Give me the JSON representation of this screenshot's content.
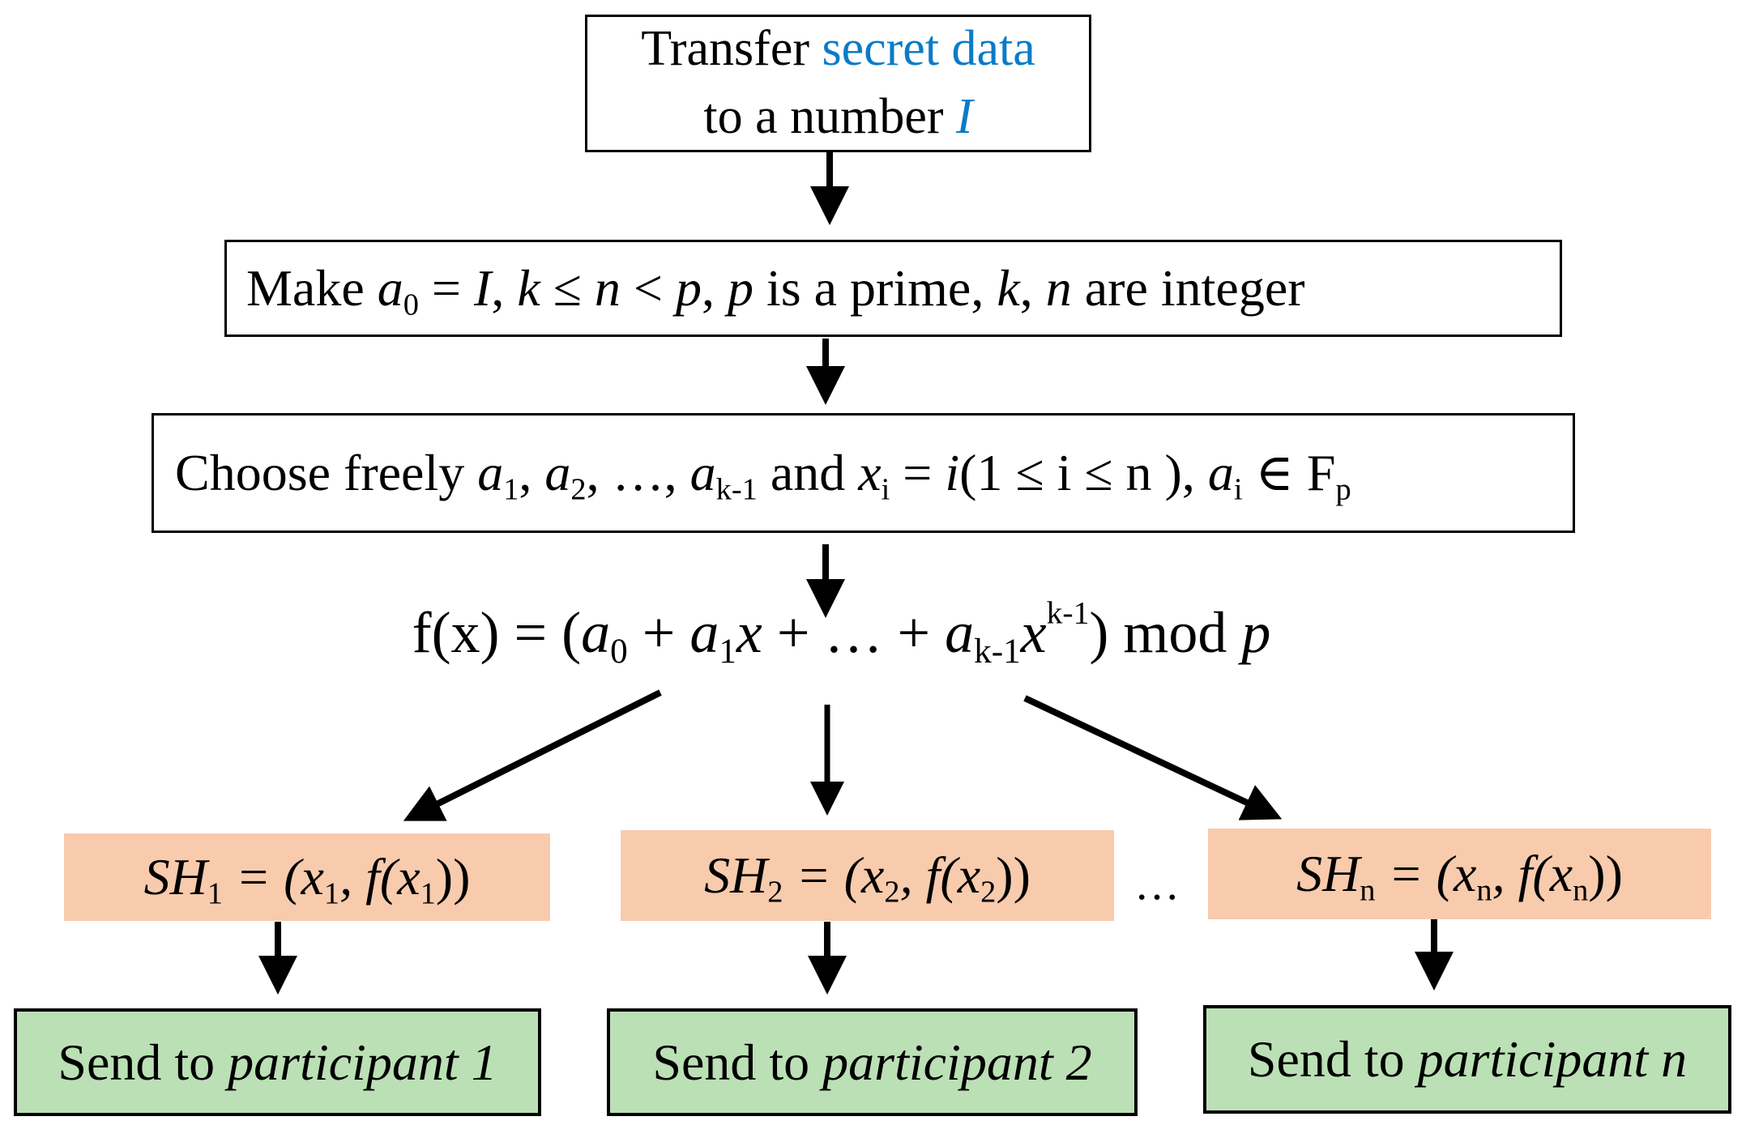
{
  "step1": {
    "pre": "Transfer ",
    "highlight": "secret data",
    "line2_pre": "to a number ",
    "line2_var": "I"
  },
  "step2": {
    "text_make": "Make ",
    "a": "a",
    "a_sub": "0",
    "eq": " = ",
    "I": "I",
    "rest_1": ", ",
    "k": "k",
    "le": " ≤ ",
    "n": "n",
    "lt": " < ",
    "p": "p",
    "comma": ", ",
    "p2": "p",
    "is_prime": " is a prime, ",
    "k2": "k",
    "comma2": ", ",
    "n2": "n",
    "are_int": " are integer"
  },
  "step3": {
    "choose": "Choose freely ",
    "coeffs": "a",
    "sub1": "1",
    "sub2": "2",
    "subk": "k-1",
    "sep": ", ",
    "dots": "…, ",
    "and": " and ",
    "x": "x",
    "xi_sub": "i",
    "eq": " = ",
    "i": "i",
    "range": "(1 ≤ i ≤ n ), ",
    "ai_sub": "i",
    "in": " ∈ F",
    "field_sub": "p"
  },
  "formula": {
    "lhs": "f(x) = (",
    "a": "a",
    "s0": "0",
    "plus": " + ",
    "s1": "1",
    "x": "x",
    "dots": " + … + ",
    "sk": "k-1",
    "exp": "k-1",
    "rhs": ") mod ",
    "p": "p"
  },
  "shares": [
    {
      "label": "SH",
      "sub": "1",
      "eq": " = (x",
      "xsub": "1",
      "mid": ", f(x",
      "end": "))"
    },
    {
      "label": "SH",
      "sub": "2",
      "eq": " = (x",
      "xsub": "2",
      "mid": ", f(x",
      "end": "))"
    },
    {
      "label": "SH",
      "sub": "n",
      "eq": " = (x",
      "xsub": "n",
      "mid": ", f(x",
      "end": "))"
    }
  ],
  "ellipsis": "…",
  "sends": [
    {
      "pre": "Send to ",
      "target": "participant 1"
    },
    {
      "pre": "Send to ",
      "target": "participant 2"
    },
    {
      "pre": "Send to ",
      "target": "participant n"
    }
  ],
  "colors": {
    "highlight": "#0a7bc8",
    "share_fill": "#f8cbad",
    "send_fill": "#bbe0b5"
  }
}
